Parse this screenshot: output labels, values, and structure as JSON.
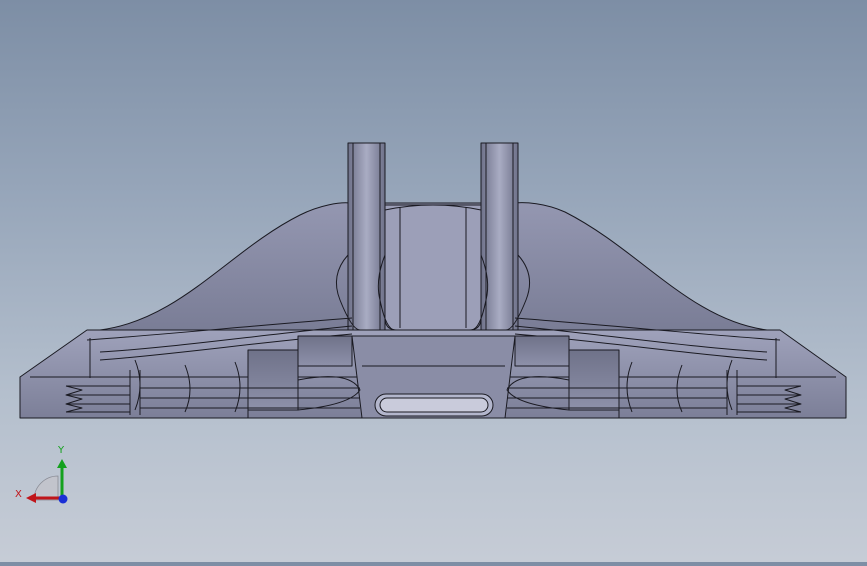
{
  "viewport": {
    "background_top": "#7d8ea5",
    "background_bottom": "#c6ccd6",
    "model_face_color": "#8a8da6",
    "model_edge_color": "#1a1a22"
  },
  "triad": {
    "x_label": "X",
    "y_label": "Y",
    "x_color": "#c0151a",
    "y_color": "#14a11e",
    "z_color": "#1a2fd6"
  }
}
